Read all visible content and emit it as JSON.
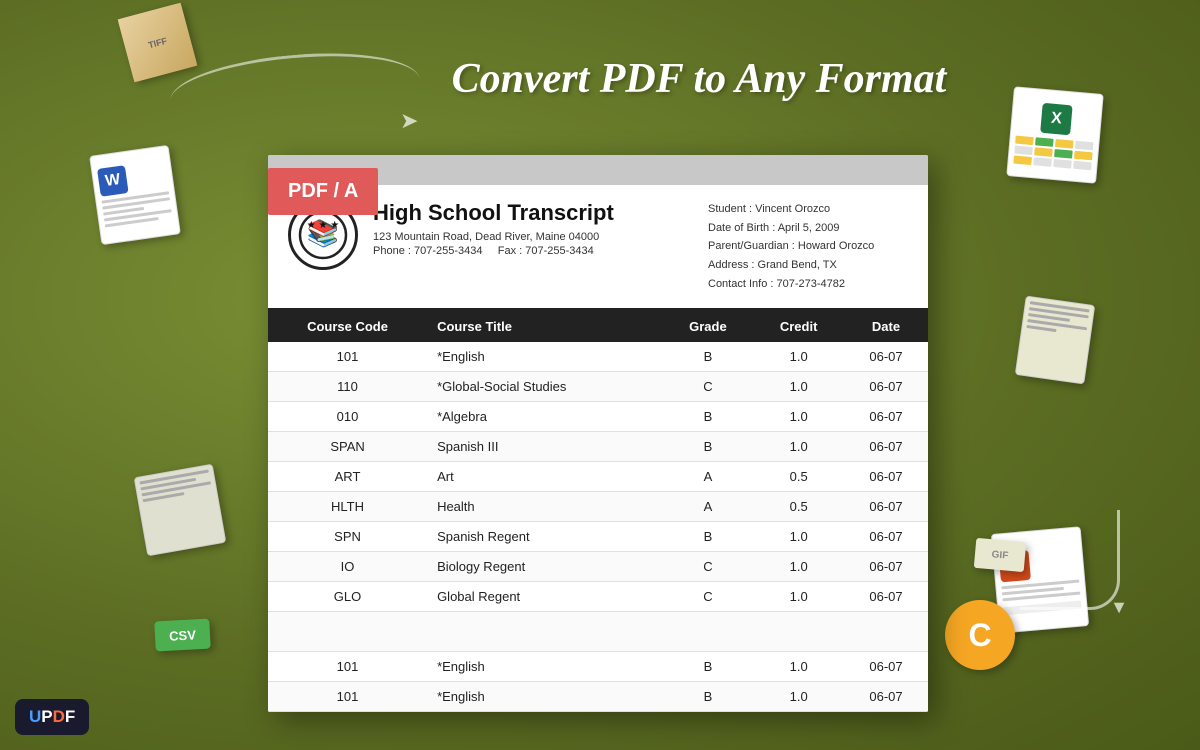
{
  "app": {
    "name": "UPDF",
    "badge_label": "UPDF"
  },
  "headline": "Convert PDF to Any Format",
  "pdf_badge": "PDF / A",
  "document": {
    "title": "High School Transcript",
    "address": "123 Mountain Road, Dead River, Maine 04000",
    "phone": "Phone : 707-255-3434",
    "fax": "Fax : 707-255-3434",
    "student_label": "Student : Vincent Orozco",
    "dob_label": "Date of Birth : April 5,  2009",
    "guardian_label": "Parent/Guardian : Howard Orozco",
    "address_label": "Address : Grand Bend, TX",
    "contact_label": "Contact Info : 707-273-4782",
    "table": {
      "headers": [
        "Course Code",
        "Course Title",
        "Grade",
        "Credit",
        "Date"
      ],
      "rows": [
        {
          "code": "101",
          "title": "*English",
          "grade": "B",
          "credit": "1.0",
          "date": "06-07"
        },
        {
          "code": "110",
          "title": "*Global-Social Studies",
          "grade": "C",
          "credit": "1.0",
          "date": "06-07"
        },
        {
          "code": "010",
          "title": "*Algebra",
          "grade": "B",
          "credit": "1.0",
          "date": "06-07"
        },
        {
          "code": "SPAN",
          "title": "Spanish III",
          "grade": "B",
          "credit": "1.0",
          "date": "06-07"
        },
        {
          "code": "ART",
          "title": "Art",
          "grade": "A",
          "credit": "0.5",
          "date": "06-07"
        },
        {
          "code": "HLTH",
          "title": "Health",
          "grade": "A",
          "credit": "0.5",
          "date": "06-07"
        },
        {
          "code": "SPN",
          "title": "Spanish Regent",
          "grade": "B",
          "credit": "1.0",
          "date": "06-07"
        },
        {
          "code": "IO",
          "title": "Biology Regent",
          "grade": "C",
          "credit": "1.0",
          "date": "06-07"
        },
        {
          "code": "GLO",
          "title": "Global Regent",
          "grade": "C",
          "credit": "1.0",
          "date": "06-07"
        },
        {
          "code": "101",
          "title": "*English",
          "grade": "B",
          "credit": "1.0",
          "date": "06-07"
        },
        {
          "code": "101",
          "title": "*English",
          "grade": "B",
          "credit": "1.0",
          "date": "06-07"
        }
      ]
    }
  },
  "decorative": {
    "tiff_label": "TIFF",
    "word_label": "W",
    "excel_label": "X",
    "csv_label": "CSV",
    "ppt_label": "P",
    "gif_label": "GIF",
    "c_label": "C"
  }
}
